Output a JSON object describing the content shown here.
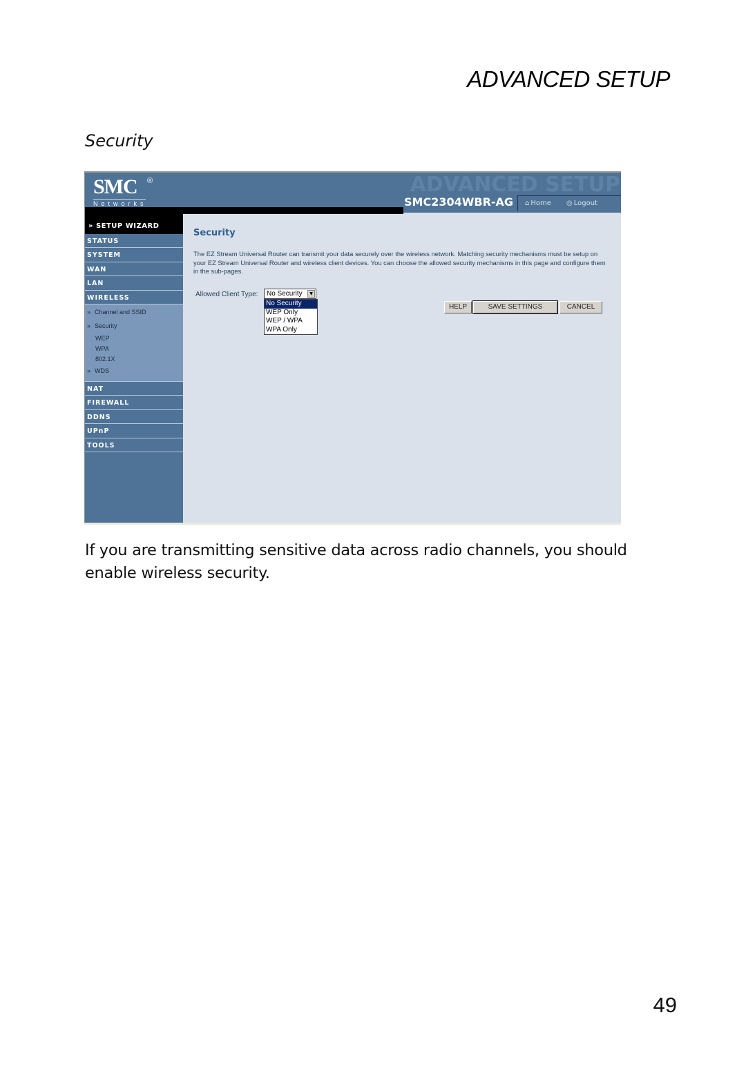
{
  "page": {
    "chapter_title": "ADVANCED SETUP",
    "section_title": "Security",
    "body_text": "If you are transmitting sensitive data across radio channels, you should enable wireless security.",
    "page_number": "49"
  },
  "router_ui": {
    "header": {
      "logo_main": "SMC",
      "logo_registered": "®",
      "logo_sub": "Networks",
      "watermark": "ADVANCED SETUP",
      "model": "SMC2304WBR-AG",
      "links": [
        {
          "label": "Home",
          "icon": "home-icon"
        },
        {
          "label": "Logout",
          "icon": "logout-icon"
        }
      ]
    },
    "sidebar": {
      "wizard": "» SETUP WIZARD",
      "items": [
        "STATUS",
        "SYSTEM",
        "WAN",
        "LAN",
        "WIRELESS"
      ],
      "wireless_sub": [
        {
          "label": "Channel and SSID",
          "marker": "»"
        },
        {
          "label": "Security",
          "marker": "»"
        }
      ],
      "security_sub": [
        "WEP",
        "WPA",
        "802.1X"
      ],
      "wds": {
        "label": "WDS",
        "marker": "»"
      },
      "items_after": [
        "NAT",
        "FIREWALL",
        "DDNS",
        "UPnP",
        "TOOLS"
      ]
    },
    "content": {
      "title": "Security",
      "description": "The EZ Stream Universal Router can transmit your data securely over the wireless network. Matching security mechanisms must be setup on your EZ Stream Universal Router and wireless client devices. You can choose the allowed security mechanisms in this page and configure them in the sub-pages.",
      "client_type_label": "Allowed Client Type:",
      "client_type_value": "No Security",
      "client_type_options": [
        "No Security",
        "WEP Only",
        "WEP / WPA",
        "WPA Only"
      ],
      "buttons": {
        "help": "HELP",
        "save": "SAVE SETTINGS",
        "cancel": "CANCEL"
      }
    }
  }
}
